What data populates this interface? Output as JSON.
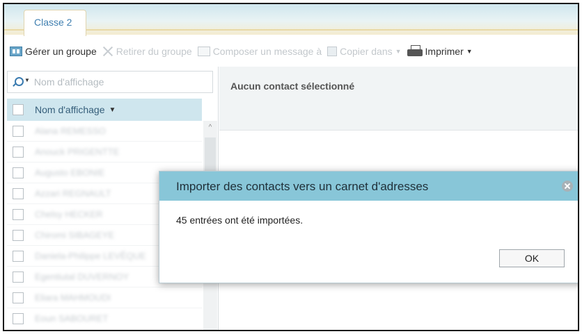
{
  "tabs": [
    {
      "label": "Classe 2"
    }
  ],
  "toolbar": {
    "manage_group": "Gérer un groupe",
    "remove_from_group": "Retirer du groupe",
    "compose_message": "Composer un message à",
    "copy_to": "Copier dans",
    "print": "Imprimer"
  },
  "search": {
    "placeholder": "Nom d'affichage"
  },
  "list": {
    "column_header": "Nom d'affichage",
    "rows": [
      "Alana REMESSO",
      "Anouck PRIGENTTE",
      "Augusto EBONIE",
      "Azzari REGNAULT",
      "Chelsy HECKER",
      "Chiromi SIBAGEYE",
      "Daniela-Philippe LEVÊQUE",
      "Egentiutal DUVERNOY",
      "Eliara MAHMOUDI",
      "Eoun SABOURET"
    ]
  },
  "detail": {
    "empty_text": "Aucun contact sélectionné"
  },
  "modal": {
    "title": "Importer des contacts vers un carnet d'adresses",
    "message": "45 entrées ont été importées.",
    "ok_label": "OK"
  },
  "colors": {
    "accent": "#88c6d8",
    "header": "#cfe6ee",
    "link": "#3f7fb0"
  }
}
